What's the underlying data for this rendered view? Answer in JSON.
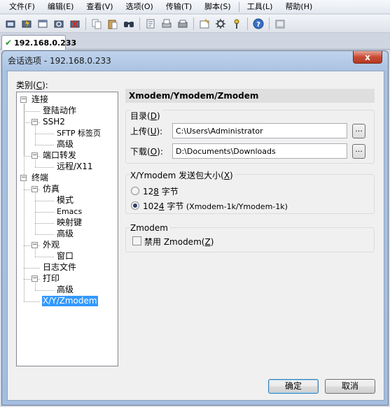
{
  "menubar": {
    "items": [
      "文件(F)",
      "编辑(E)",
      "查看(V)",
      "选项(O)",
      "传输(T)",
      "脚本(S)",
      "工具(L)",
      "帮助(H)"
    ]
  },
  "toolbar": {
    "icons": [
      "connect-icon",
      "quick-connect-icon",
      "connect-tab-icon",
      "reconnect-icon",
      "disconnect-icon",
      "copy-icon",
      "paste-icon",
      "find-icon",
      "print-setup-icon",
      "print-icon",
      "printer-icon",
      "session-options-icon",
      "global-options-icon",
      "keymap-icon",
      "help-icon",
      "screen-icon"
    ]
  },
  "tab": {
    "label": "192.168.0.233"
  },
  "dialog": {
    "title": "会话选项 - 192.168.0.233",
    "close_glyph": "x",
    "category_label_prefix": "类别(",
    "category_label_key": "C",
    "category_label_suffix": "):",
    "tree": [
      {
        "label": "连接",
        "level": 0,
        "toggle": "-"
      },
      {
        "label": "登陆动作",
        "level": 1
      },
      {
        "label": "SSH2",
        "level": 1,
        "toggle": "-"
      },
      {
        "label": "SFTP 标签页",
        "level": 2
      },
      {
        "label": "高级",
        "level": 2
      },
      {
        "label": "端口转发",
        "level": 1,
        "toggle": "-"
      },
      {
        "label": "远程/X11",
        "level": 2
      },
      {
        "label": "终端",
        "level": 0,
        "toggle": "-"
      },
      {
        "label": "仿真",
        "level": 1,
        "toggle": "-"
      },
      {
        "label": "模式",
        "level": 2
      },
      {
        "label": "Emacs",
        "level": 2
      },
      {
        "label": "映射键",
        "level": 2
      },
      {
        "label": "高级",
        "level": 2
      },
      {
        "label": "外观",
        "level": 1,
        "toggle": "-"
      },
      {
        "label": "窗口",
        "level": 2
      },
      {
        "label": "日志文件",
        "level": 1
      },
      {
        "label": "打印",
        "level": 1,
        "toggle": "-"
      },
      {
        "label": "高级",
        "level": 2
      },
      {
        "label": "X/Y/Zmodem",
        "level": 1,
        "selected": true
      }
    ],
    "panel_title": "Xmodem/Ymodem/Zmodem",
    "directory": {
      "title_prefix": "目录(",
      "title_key": "D",
      "title_suffix": ")",
      "upload_prefix": "上传(",
      "upload_key": "U",
      "upload_suffix": "):",
      "upload_value": "C:\\Users\\Administrator",
      "download_prefix": "下载(",
      "download_key": "O",
      "download_suffix": "):",
      "download_value": "D:\\Documents\\Downloads",
      "browse_label": "..."
    },
    "packet": {
      "title_prefix": "X/Ymodem 发送包大小(",
      "title_key": "X",
      "title_suffix": ")",
      "opt128_pre": "12",
      "opt128_key": "8",
      "opt128_post": " 字节",
      "opt1024_pre": "102",
      "opt1024_key": "4",
      "opt1024_post": " 字节",
      "opt1024_note": " (Xmodem-1k/Ymodem-1k)",
      "selected": "1024"
    },
    "zmodem": {
      "title": "Zmodem",
      "disable_prefix": "禁用 Zmodem(",
      "disable_key": "Z",
      "disable_suffix": ")",
      "disable_checked": false
    },
    "ok_label": "确定",
    "cancel_label": "取消"
  }
}
